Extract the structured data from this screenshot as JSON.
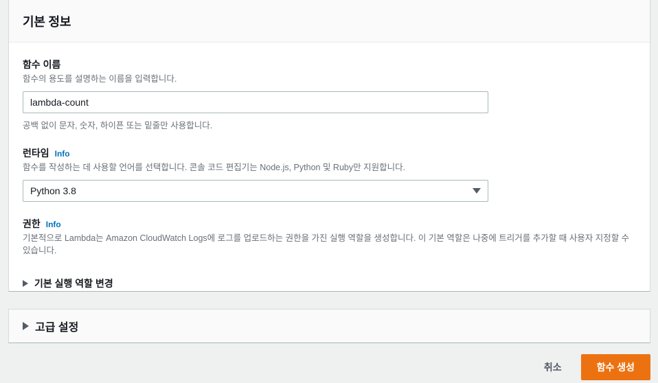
{
  "basic_info": {
    "title": "기본 정보",
    "function_name": {
      "label": "함수 이름",
      "description": "함수의 용도를 설명하는 이름을 입력합니다.",
      "value": "lambda-count",
      "placeholder": "",
      "hint": "공백 없이 문자, 숫자, 하이픈 또는 밑줄만 사용합니다."
    },
    "runtime": {
      "label": "런타임",
      "info_label": "Info",
      "description": "함수를 작성하는 데 사용할 언어를 선택합니다. 콘솔 코드 편집기는 Node.js, Python 및 Ruby만 지원합니다.",
      "selected": "Python 3.8"
    },
    "permissions": {
      "label": "권한",
      "info_label": "Info",
      "description": "기본적으로 Lambda는 Amazon CloudWatch Logs에 로그를 업로드하는 권한을 가진 실행 역할을 생성합니다. 이 기본 역할은 나중에 트리거를 추가할 때 사용자 지정할 수 있습니다.",
      "expander_label": "기본 실행 역할 변경"
    }
  },
  "advanced": {
    "expander_label": "고급 설정"
  },
  "footer": {
    "cancel_label": "취소",
    "submit_label": "함수 생성"
  },
  "colors": {
    "accent_orange": "#ec7211",
    "link_blue": "#0073bb",
    "text_dark": "#16191f",
    "text_muted": "#687078",
    "page_background": "#eff0f0"
  },
  "icons": {
    "dropdown": "chevron-down-icon",
    "expander": "triangle-right-icon"
  }
}
